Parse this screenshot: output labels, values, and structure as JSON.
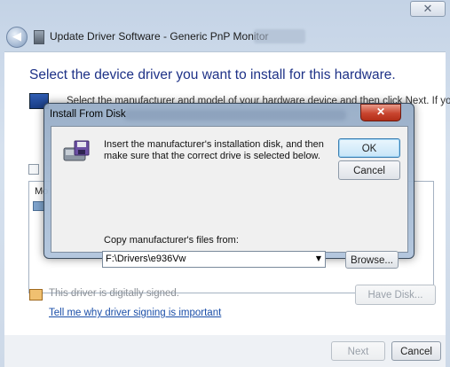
{
  "window": {
    "title": "Update Driver Software - Generic PnP Monitor",
    "close_glyph": "✕"
  },
  "wizard": {
    "heading": "Select the device driver you want to install for this hardware.",
    "instruction": "Select the manufacturer and model of your hardware device and then click Next. If you",
    "list_fragment": "Mo",
    "signed_text": "This driver is digitally signed.",
    "signing_link": "Tell me why driver signing is important",
    "have_disk_label": "Have Disk...",
    "next_label": "Next",
    "cancel_label": "Cancel"
  },
  "dialog": {
    "title": "Install From Disk",
    "close_glyph": "✕",
    "message": "Insert the manufacturer's installation disk, and then make sure that the correct drive is selected below.",
    "ok_label": "OK",
    "cancel_label": "Cancel",
    "copy_label": "Copy manufacturer's files from:",
    "path_value": "F:\\Drivers\\e936Vw",
    "browse_label": "Browse..."
  },
  "icons": {
    "back": "back-arrow-icon",
    "disk": "install-disk-icon",
    "monitor": "monitor-icon",
    "certificate": "certificate-icon"
  }
}
